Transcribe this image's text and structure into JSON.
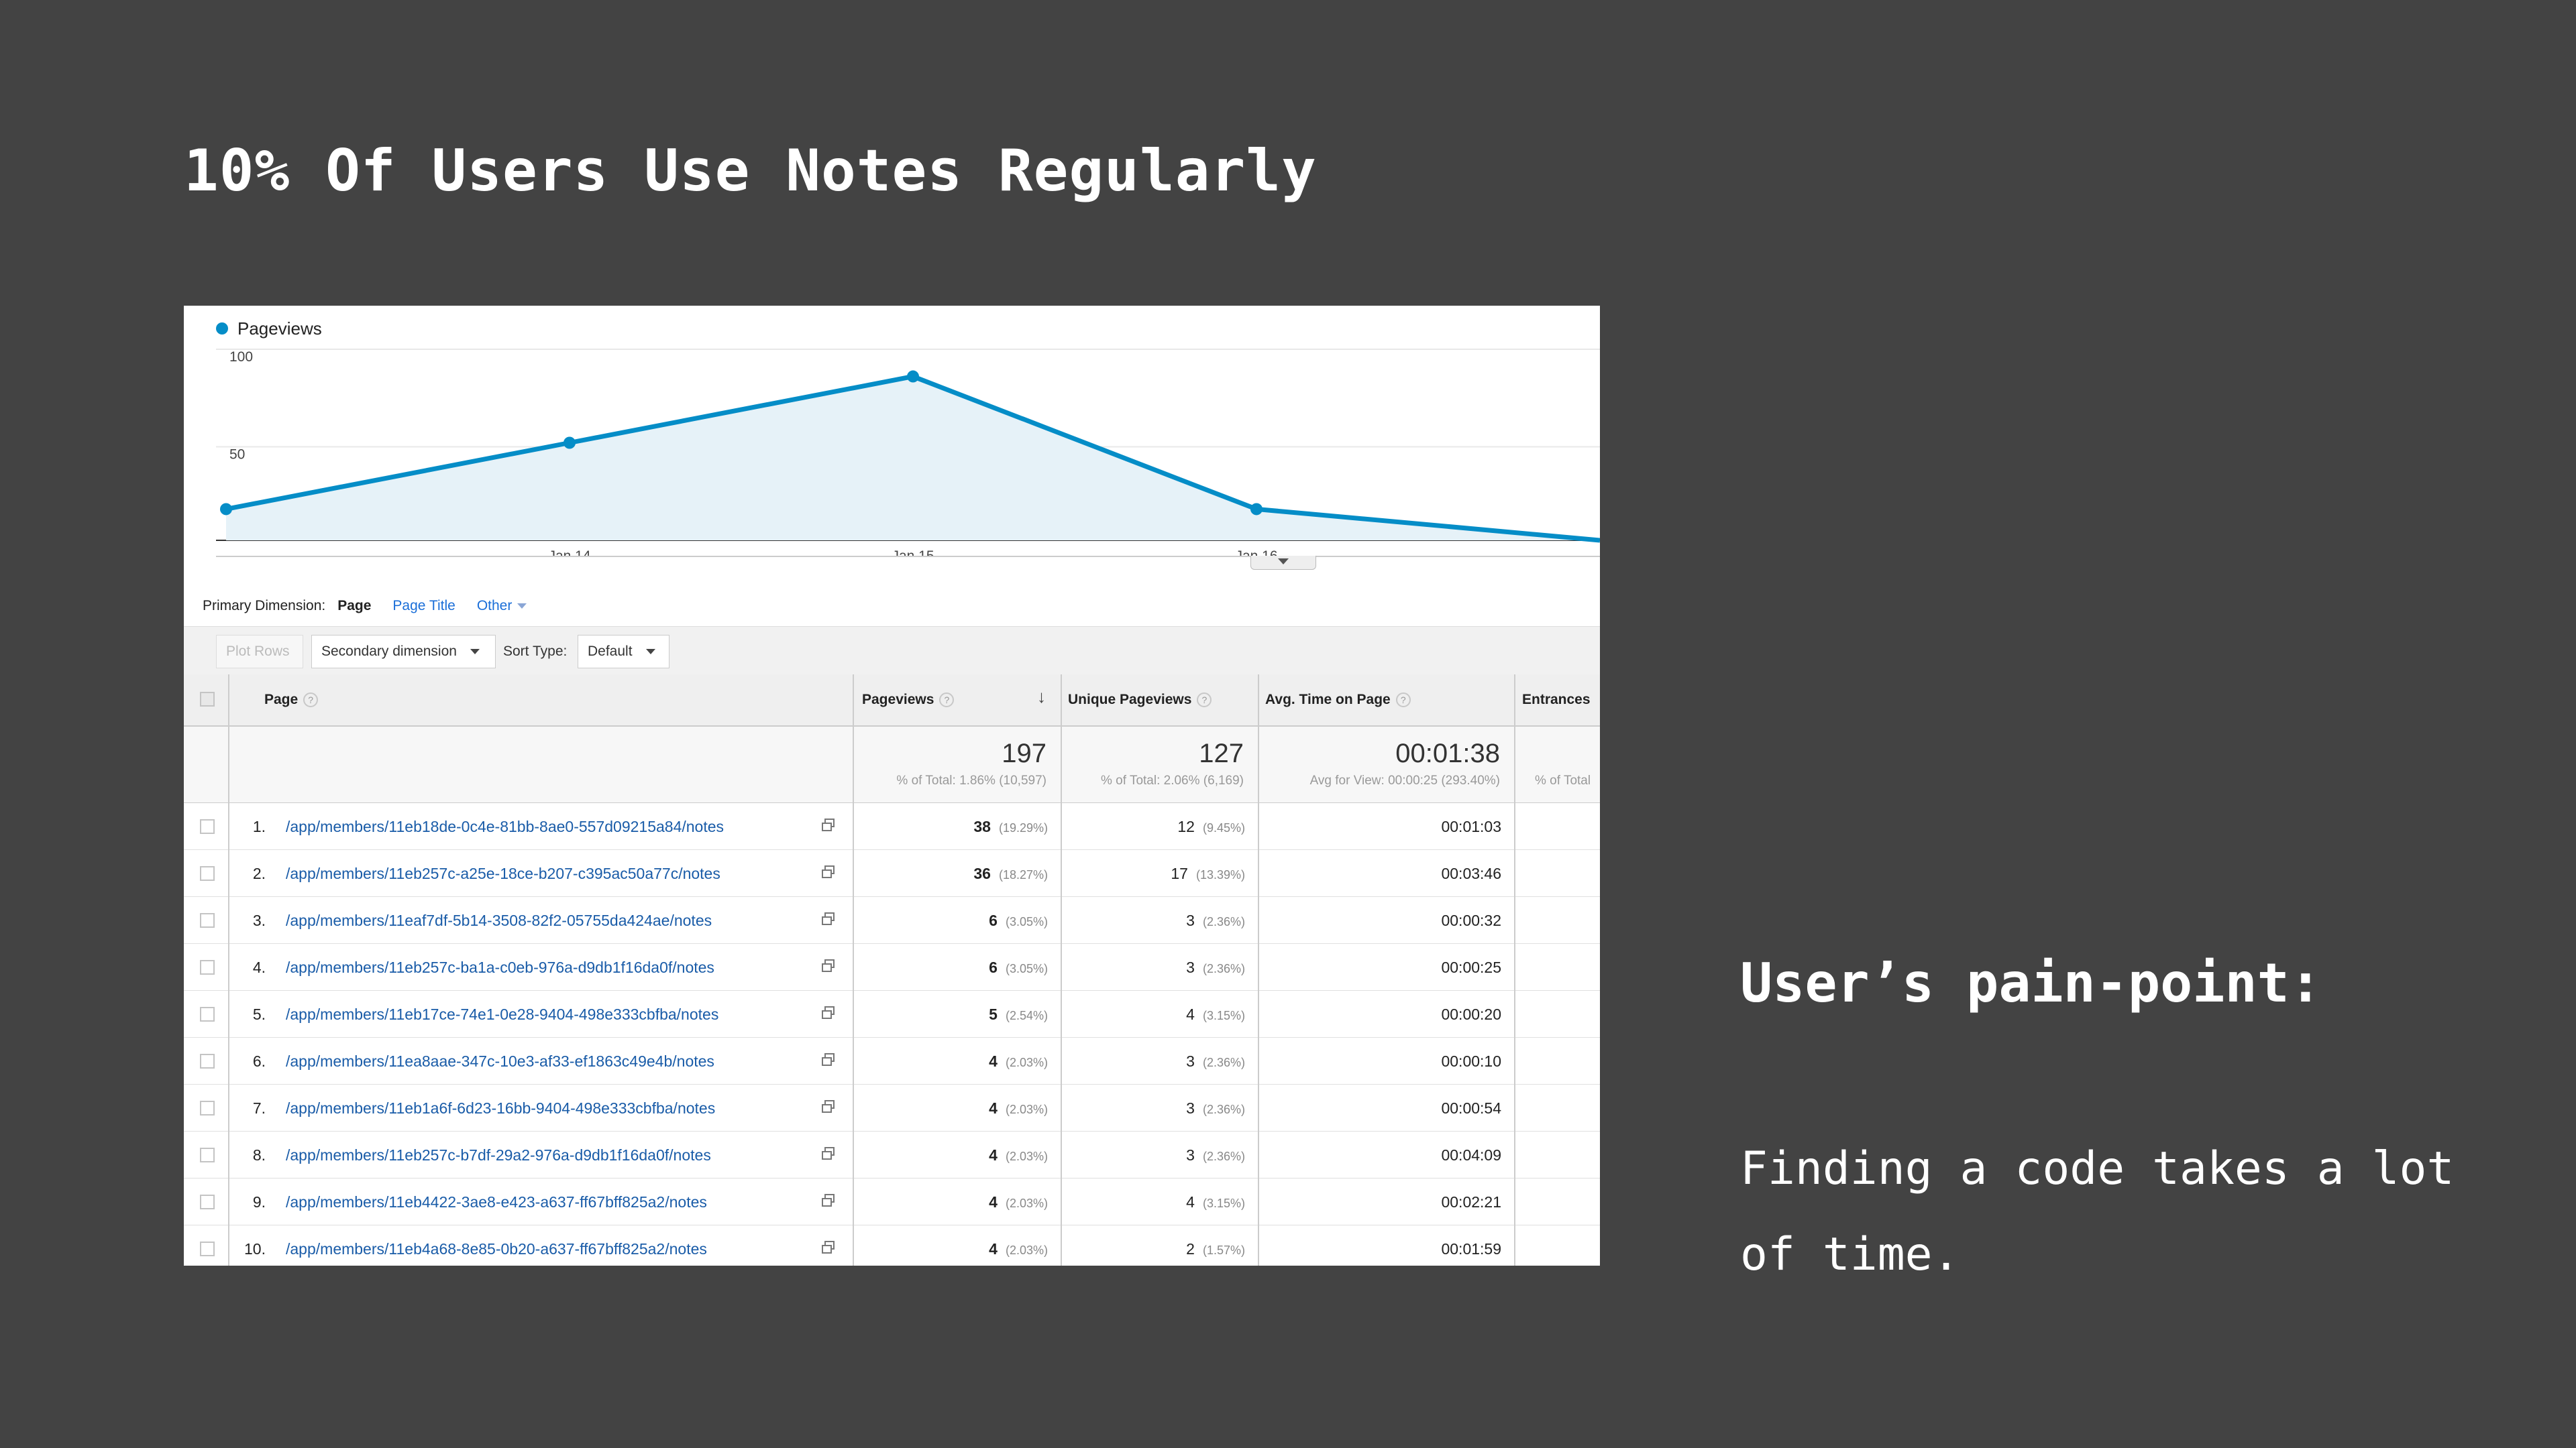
{
  "slide": {
    "title": "10% Of Users Use Notes Regularly",
    "pain_title": "User’s pain-point:",
    "pain_body": "Finding a code takes a lot of time."
  },
  "chart_data": {
    "type": "area",
    "legend": "Pageviews",
    "x": [
      "...",
      "Jan 14",
      "Jan 15",
      "Jan 16",
      ""
    ],
    "y_ticks": [
      "100",
      "50"
    ],
    "ylim": [
      0,
      100
    ],
    "series": [
      {
        "name": "Pageviews",
        "values": [
          16,
          50,
          84,
          16,
          0
        ]
      }
    ],
    "colors": {
      "line": "#058dc7",
      "fill": "#e6f2f8"
    }
  },
  "dimension": {
    "label": "Primary Dimension:",
    "selected": "Page",
    "page_title": "Page Title",
    "other": "Other"
  },
  "toolbar": {
    "plot_rows": "Plot Rows",
    "secondary": "Secondary dimension",
    "sort_label": "Sort Type:",
    "sort_value": "Default"
  },
  "table": {
    "headers": {
      "page": "Page",
      "pageviews": "Pageviews",
      "unique": "Unique Pageviews",
      "avg_time": "Avg. Time on Page",
      "entrances": "Entrances"
    },
    "totals": {
      "pageviews": "197",
      "pageviews_sub": "% of Total: 1.86% (10,597)",
      "unique": "127",
      "unique_sub": "% of Total: 2.06% (6,169)",
      "avg_time": "00:01:38",
      "avg_time_sub": "Avg for View: 00:00:25 (293.40%)",
      "entrances_sub": "% of Total"
    },
    "rows": [
      {
        "n": "1.",
        "page": "/app/members/11eb18de-0c4e-81bb-8ae0-557d09215a84/notes",
        "pv": "38",
        "pv_pct": "(19.29%)",
        "upv": "12",
        "upv_pct": "(9.45%)",
        "time": "00:01:03"
      },
      {
        "n": "2.",
        "page": "/app/members/11eb257c-a25e-18ce-b207-c395ac50a77c/notes",
        "pv": "36",
        "pv_pct": "(18.27%)",
        "upv": "17",
        "upv_pct": "(13.39%)",
        "time": "00:03:46"
      },
      {
        "n": "3.",
        "page": "/app/members/11eaf7df-5b14-3508-82f2-05755da424ae/notes",
        "pv": "6",
        "pv_pct": "(3.05%)",
        "upv": "3",
        "upv_pct": "(2.36%)",
        "time": "00:00:32"
      },
      {
        "n": "4.",
        "page": "/app/members/11eb257c-ba1a-c0eb-976a-d9db1f16da0f/notes",
        "pv": "6",
        "pv_pct": "(3.05%)",
        "upv": "3",
        "upv_pct": "(2.36%)",
        "time": "00:00:25"
      },
      {
        "n": "5.",
        "page": "/app/members/11eb17ce-74e1-0e28-9404-498e333cbfba/notes",
        "pv": "5",
        "pv_pct": "(2.54%)",
        "upv": "4",
        "upv_pct": "(3.15%)",
        "time": "00:00:20"
      },
      {
        "n": "6.",
        "page": "/app/members/11ea8aae-347c-10e3-af33-ef1863c49e4b/notes",
        "pv": "4",
        "pv_pct": "(2.03%)",
        "upv": "3",
        "upv_pct": "(2.36%)",
        "time": "00:00:10"
      },
      {
        "n": "7.",
        "page": "/app/members/11eb1a6f-6d23-16bb-9404-498e333cbfba/notes",
        "pv": "4",
        "pv_pct": "(2.03%)",
        "upv": "3",
        "upv_pct": "(2.36%)",
        "time": "00:00:54"
      },
      {
        "n": "8.",
        "page": "/app/members/11eb257c-b7df-29a2-976a-d9db1f16da0f/notes",
        "pv": "4",
        "pv_pct": "(2.03%)",
        "upv": "3",
        "upv_pct": "(2.36%)",
        "time": "00:04:09"
      },
      {
        "n": "9.",
        "page": "/app/members/11eb4422-3ae8-e423-a637-ff67bff825a2/notes",
        "pv": "4",
        "pv_pct": "(2.03%)",
        "upv": "4",
        "upv_pct": "(3.15%)",
        "time": "00:02:21"
      },
      {
        "n": "10.",
        "page": "/app/members/11eb4a68-8e85-0b20-a637-ff67bff825a2/notes",
        "pv": "4",
        "pv_pct": "(2.03%)",
        "upv": "2",
        "upv_pct": "(1.57%)",
        "time": "00:01:59"
      }
    ]
  }
}
